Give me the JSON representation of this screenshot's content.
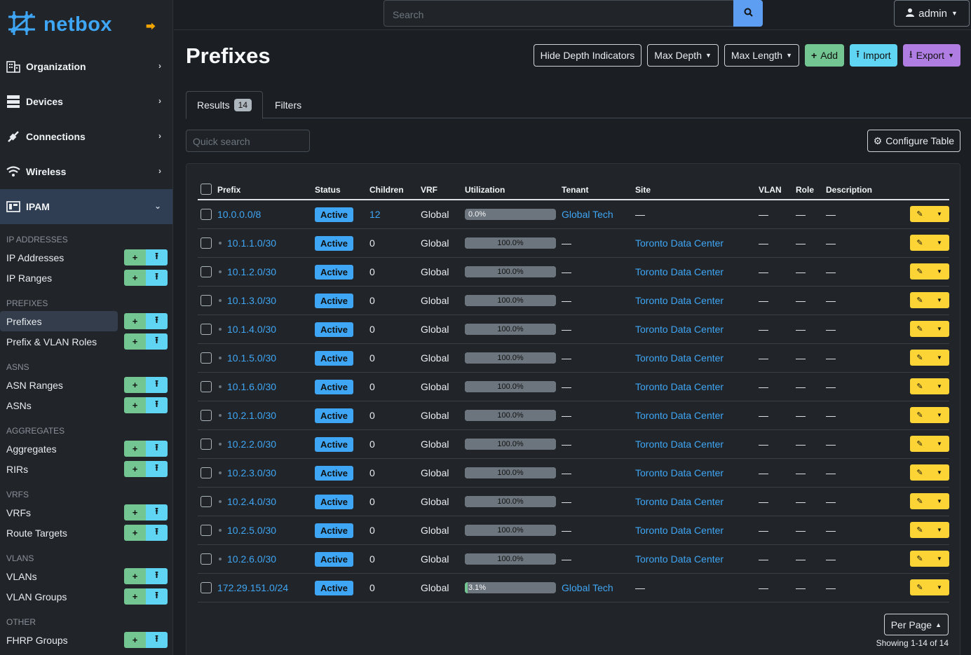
{
  "brand": {
    "name": "netbox"
  },
  "nav_groups": [
    {
      "label": "Organization",
      "icon": "building-icon"
    },
    {
      "label": "Devices",
      "icon": "server-icon"
    },
    {
      "label": "Connections",
      "icon": "plug-icon"
    },
    {
      "label": "Wireless",
      "icon": "wifi-icon"
    },
    {
      "label": "IPAM",
      "icon": "ipam-icon"
    }
  ],
  "sidebar_sections": [
    {
      "title": "IP ADDRESSES",
      "items": [
        {
          "label": "IP Addresses"
        },
        {
          "label": "IP Ranges"
        }
      ]
    },
    {
      "title": "PREFIXES",
      "items": [
        {
          "label": "Prefixes"
        },
        {
          "label": "Prefix & VLAN Roles"
        }
      ]
    },
    {
      "title": "ASNS",
      "items": [
        {
          "label": "ASN Ranges"
        },
        {
          "label": "ASNs"
        }
      ]
    },
    {
      "title": "AGGREGATES",
      "items": [
        {
          "label": "Aggregates"
        },
        {
          "label": "RIRs"
        }
      ]
    },
    {
      "title": "VRFS",
      "items": [
        {
          "label": "VRFs"
        },
        {
          "label": "Route Targets"
        }
      ]
    },
    {
      "title": "VLANS",
      "items": [
        {
          "label": "VLANs"
        },
        {
          "label": "VLAN Groups"
        }
      ]
    },
    {
      "title": "OTHER",
      "items": [
        {
          "label": "FHRP Groups"
        }
      ]
    }
  ],
  "topbar": {
    "search_placeholder": "Search",
    "user": "admin"
  },
  "page": {
    "title": "Prefixes",
    "actions": {
      "hide_depth": "Hide Depth Indicators",
      "max_depth": "Max Depth",
      "max_length": "Max Length",
      "add": "Add",
      "import": "Import",
      "export": "Export"
    },
    "tabs": {
      "results": "Results",
      "results_count": "14",
      "filters": "Filters"
    },
    "quick_search_placeholder": "Quick search",
    "configure_table": "Configure Table",
    "per_page": "Per Page",
    "showing": "Showing 1-14 of 14"
  },
  "table": {
    "columns": {
      "prefix": "Prefix",
      "status": "Status",
      "children": "Children",
      "vrf": "VRF",
      "utilization": "Utilization",
      "tenant": "Tenant",
      "site": "Site",
      "vlan": "VLAN",
      "role": "Role",
      "description": "Description"
    },
    "rows": [
      {
        "prefix": "10.0.0.0/8",
        "child": false,
        "status": "Active",
        "children": "12",
        "vrf": "Global",
        "util": 0.0,
        "util_label": "0.0%",
        "tenant": "Global Tech",
        "site": "—",
        "vlan": "—",
        "role": "—",
        "desc": "—"
      },
      {
        "prefix": "10.1.1.0/30",
        "child": true,
        "status": "Active",
        "children": "0",
        "vrf": "Global",
        "util": 100.0,
        "util_label": "100.0%",
        "tenant": "—",
        "site": "Toronto Data Center",
        "vlan": "—",
        "role": "—",
        "desc": "—"
      },
      {
        "prefix": "10.1.2.0/30",
        "child": true,
        "status": "Active",
        "children": "0",
        "vrf": "Global",
        "util": 100.0,
        "util_label": "100.0%",
        "tenant": "—",
        "site": "Toronto Data Center",
        "vlan": "—",
        "role": "—",
        "desc": "—"
      },
      {
        "prefix": "10.1.3.0/30",
        "child": true,
        "status": "Active",
        "children": "0",
        "vrf": "Global",
        "util": 100.0,
        "util_label": "100.0%",
        "tenant": "—",
        "site": "Toronto Data Center",
        "vlan": "—",
        "role": "—",
        "desc": "—"
      },
      {
        "prefix": "10.1.4.0/30",
        "child": true,
        "status": "Active",
        "children": "0",
        "vrf": "Global",
        "util": 100.0,
        "util_label": "100.0%",
        "tenant": "—",
        "site": "Toronto Data Center",
        "vlan": "—",
        "role": "—",
        "desc": "—"
      },
      {
        "prefix": "10.1.5.0/30",
        "child": true,
        "status": "Active",
        "children": "0",
        "vrf": "Global",
        "util": 100.0,
        "util_label": "100.0%",
        "tenant": "—",
        "site": "Toronto Data Center",
        "vlan": "—",
        "role": "—",
        "desc": "—"
      },
      {
        "prefix": "10.1.6.0/30",
        "child": true,
        "status": "Active",
        "children": "0",
        "vrf": "Global",
        "util": 100.0,
        "util_label": "100.0%",
        "tenant": "—",
        "site": "Toronto Data Center",
        "vlan": "—",
        "role": "—",
        "desc": "—"
      },
      {
        "prefix": "10.2.1.0/30",
        "child": true,
        "status": "Active",
        "children": "0",
        "vrf": "Global",
        "util": 100.0,
        "util_label": "100.0%",
        "tenant": "—",
        "site": "Toronto Data Center",
        "vlan": "—",
        "role": "—",
        "desc": "—"
      },
      {
        "prefix": "10.2.2.0/30",
        "child": true,
        "status": "Active",
        "children": "0",
        "vrf": "Global",
        "util": 100.0,
        "util_label": "100.0%",
        "tenant": "—",
        "site": "Toronto Data Center",
        "vlan": "—",
        "role": "—",
        "desc": "—"
      },
      {
        "prefix": "10.2.3.0/30",
        "child": true,
        "status": "Active",
        "children": "0",
        "vrf": "Global",
        "util": 100.0,
        "util_label": "100.0%",
        "tenant": "—",
        "site": "Toronto Data Center",
        "vlan": "—",
        "role": "—",
        "desc": "—"
      },
      {
        "prefix": "10.2.4.0/30",
        "child": true,
        "status": "Active",
        "children": "0",
        "vrf": "Global",
        "util": 100.0,
        "util_label": "100.0%",
        "tenant": "—",
        "site": "Toronto Data Center",
        "vlan": "—",
        "role": "—",
        "desc": "—"
      },
      {
        "prefix": "10.2.5.0/30",
        "child": true,
        "status": "Active",
        "children": "0",
        "vrf": "Global",
        "util": 100.0,
        "util_label": "100.0%",
        "tenant": "—",
        "site": "Toronto Data Center",
        "vlan": "—",
        "role": "—",
        "desc": "—"
      },
      {
        "prefix": "10.2.6.0/30",
        "child": true,
        "status": "Active",
        "children": "0",
        "vrf": "Global",
        "util": 100.0,
        "util_label": "100.0%",
        "tenant": "—",
        "site": "Toronto Data Center",
        "vlan": "—",
        "role": "—",
        "desc": "—"
      },
      {
        "prefix": "172.29.151.0/24",
        "child": false,
        "status": "Active",
        "children": "0",
        "vrf": "Global",
        "util": 3.1,
        "util_label": "3.1%",
        "tenant": "Global Tech",
        "site": "—",
        "vlan": "—",
        "role": "—",
        "desc": "—"
      }
    ]
  },
  "colors": {
    "accent": "#3fa6f5",
    "add": "#73c691",
    "import": "#5fd4f3",
    "export": "#b07ee3",
    "edit": "#fcd436"
  }
}
